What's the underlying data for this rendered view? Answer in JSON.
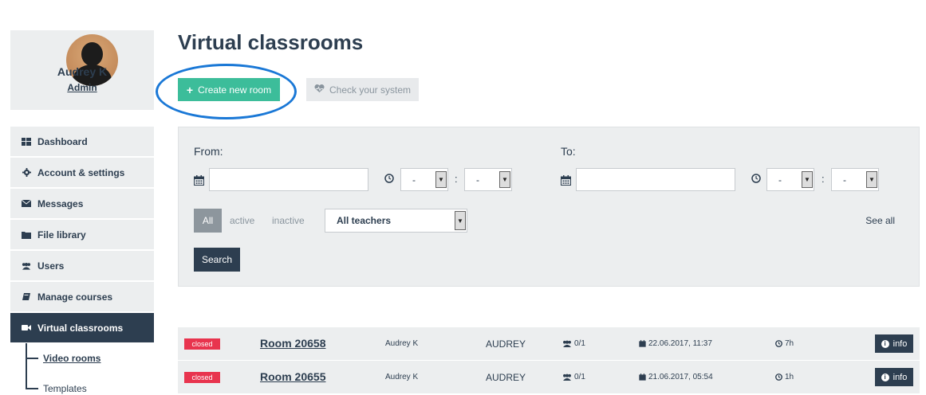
{
  "profile": {
    "name": "Audrey K",
    "role": "Admin"
  },
  "sidebar": {
    "items": [
      {
        "label": "Dashboard",
        "icon": "dashboard-icon"
      },
      {
        "label": "Account & settings",
        "icon": "gear-icon"
      },
      {
        "label": "Messages",
        "icon": "envelope-icon"
      },
      {
        "label": "File library",
        "icon": "folder-icon"
      },
      {
        "label": "Users",
        "icon": "users-icon"
      },
      {
        "label": "Manage courses",
        "icon": "book-icon"
      },
      {
        "label": "Virtual classrooms",
        "icon": "video-camera-icon",
        "active": true
      }
    ],
    "subitems": [
      {
        "label": "Video rooms",
        "active": true
      },
      {
        "label": "Templates"
      }
    ]
  },
  "main": {
    "title": "Virtual classrooms",
    "create_button": "Create new room",
    "check_button": "Check your system",
    "highlight_color": "#1a78d6"
  },
  "filter": {
    "from_label": "From:",
    "to_label": "To:",
    "from_hour": "-",
    "from_minute": "-",
    "to_hour": "-",
    "to_minute": "-",
    "colon": ":",
    "segments": {
      "all": "All",
      "active": "active",
      "inactive": "inactive"
    },
    "teacher_select": "All teachers",
    "see_all": "See all",
    "search_button": "Search"
  },
  "rooms": [
    {
      "status": "closed",
      "name": "Room 20658",
      "owner": "Audrey K",
      "owner_upper": "AUDREY",
      "participants": "0/1",
      "datetime": "22.06.2017, 11:37",
      "duration": "7h",
      "info": "info"
    },
    {
      "status": "closed",
      "name": "Room 20655",
      "owner": "Audrey K",
      "owner_upper": "AUDREY",
      "participants": "0/1",
      "datetime": "21.06.2017, 05:54",
      "duration": "1h",
      "info": "info"
    }
  ],
  "colors": {
    "primary": "#2d3e50",
    "accent": "#3cbd9a",
    "danger": "#e8344e",
    "panel": "#eceeef"
  }
}
